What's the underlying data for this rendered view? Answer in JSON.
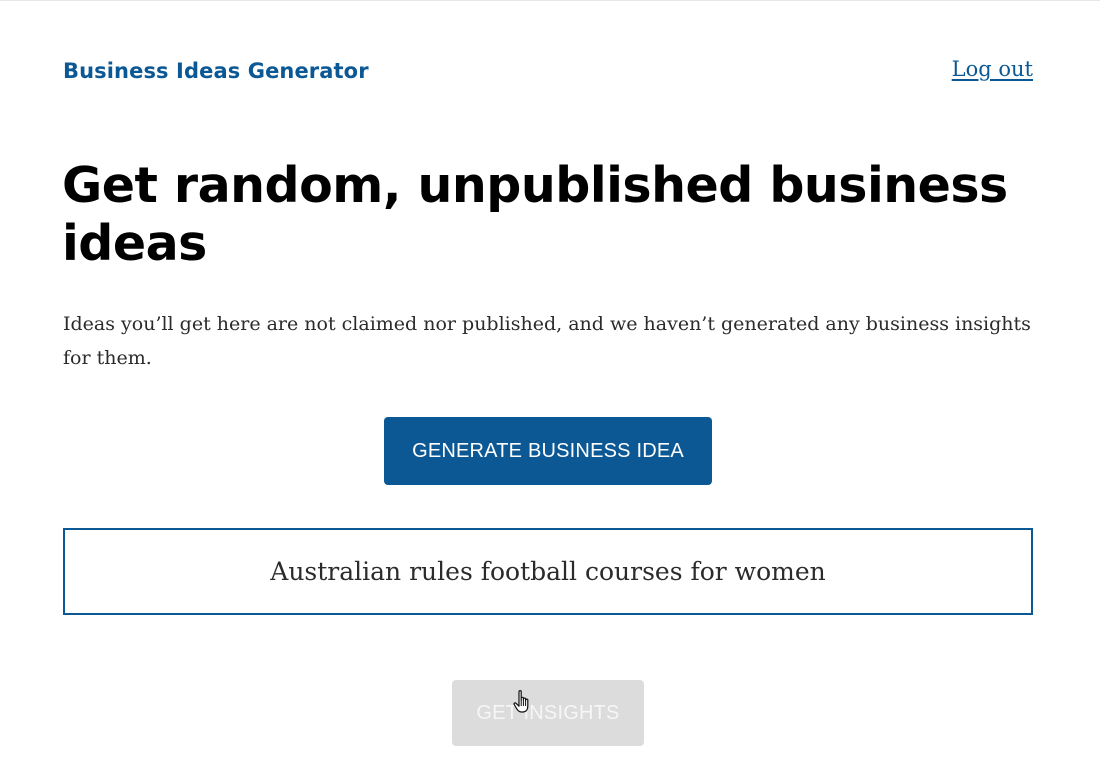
{
  "header": {
    "brand": "Business Ideas Generator",
    "logout_label": "Log out"
  },
  "main": {
    "headline": "Get random, unpublished business ideas",
    "intro": "Ideas you’ll get here are not claimed nor published, and we haven’t generated any business insights for them.",
    "generate_label": "GENERATE BUSINESS IDEA",
    "idea_text": "Australian rules football courses for women",
    "insights_label": "GET INSIGHTS"
  },
  "colors": {
    "brand_blue": "#0b5895",
    "disabled_button": "#dcdcdc",
    "text_dark": "#2b2b2b"
  },
  "icons": {
    "cursor": "hand-pointer-icon"
  }
}
